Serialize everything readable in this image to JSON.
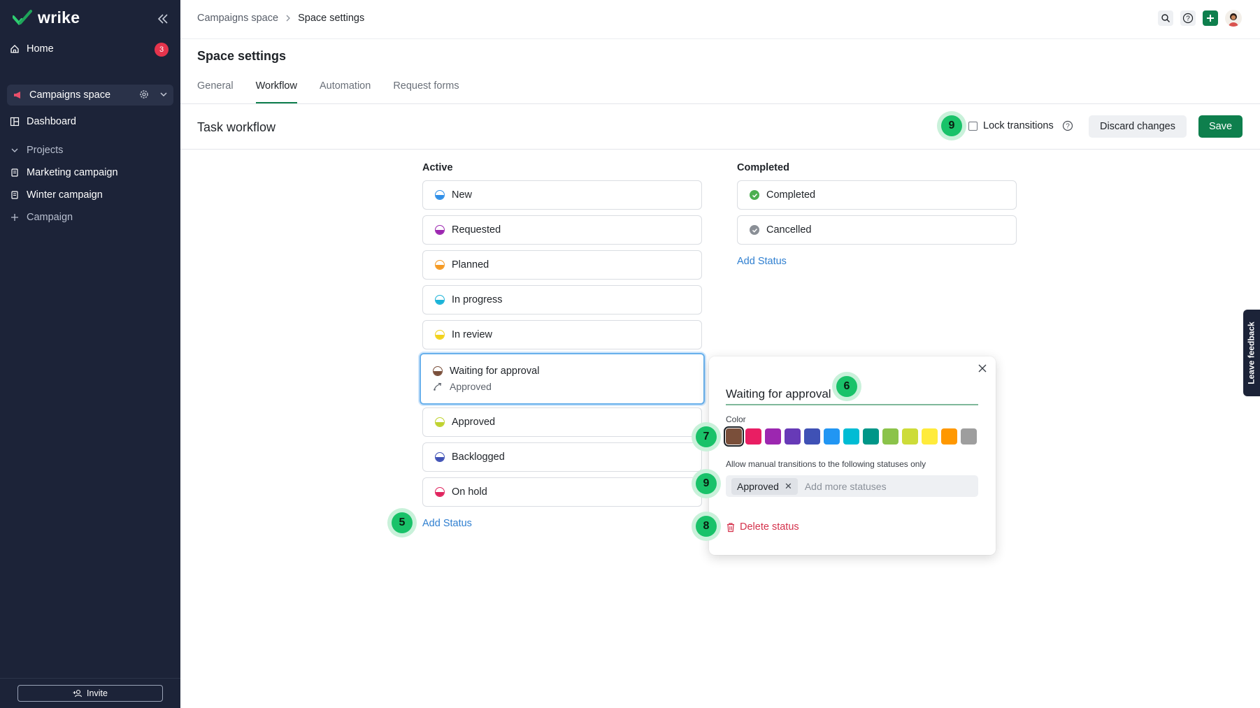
{
  "app": {
    "logo_text": "wrike"
  },
  "sidebar": {
    "home_label": "Home",
    "home_badge": "3",
    "space_name": "Campaigns space",
    "dashboard_label": "Dashboard",
    "projects_label": "Projects",
    "items": [
      {
        "label": "Marketing campaign"
      },
      {
        "label": "Winter campaign"
      }
    ],
    "add_campaign_label": "Campaign",
    "invite_label": "Invite"
  },
  "header": {
    "breadcrumb": [
      "Campaigns space",
      "Space settings"
    ],
    "page_title": "Space settings"
  },
  "tabs": [
    {
      "label": "General",
      "active": false
    },
    {
      "label": "Workflow",
      "active": true
    },
    {
      "label": "Automation",
      "active": false
    },
    {
      "label": "Request forms",
      "active": false
    }
  ],
  "workflow": {
    "title": "Task workflow",
    "lock_label": "Lock transitions",
    "discard_label": "Discard changes",
    "save_label": "Save"
  },
  "active_column": {
    "title": "Active",
    "statuses": [
      {
        "label": "New",
        "color": "#2f8fe8"
      },
      {
        "label": "Requested",
        "color": "#9c27b0"
      },
      {
        "label": "Planned",
        "color": "#f59a23"
      },
      {
        "label": "In progress",
        "color": "#1bb3d8"
      },
      {
        "label": "In review",
        "color": "#f2d21b"
      },
      {
        "label": "Waiting for approval",
        "color": "#7a4f3a",
        "transition": "Approved"
      },
      {
        "label": "Approved",
        "color": "#bfd22e"
      },
      {
        "label": "Backlogged",
        "color": "#3f51b5"
      },
      {
        "label": "On hold",
        "color": "#e0245e"
      }
    ],
    "add_status_label": "Add Status"
  },
  "completed_column": {
    "title": "Completed",
    "statuses": [
      {
        "label": "Completed",
        "color": "#4caf50"
      },
      {
        "label": "Cancelled",
        "color": "#8a8f96"
      }
    ],
    "add_status_label": "Add Status"
  },
  "popover": {
    "status_name": "Waiting for approval",
    "color_label": "Color",
    "colors": [
      "#7a4f3a",
      "#e91e63",
      "#9c27b0",
      "#673ab7",
      "#3f51b5",
      "#2196f3",
      "#00bcd4",
      "#009688",
      "#8bc34a",
      "#cddc39",
      "#ffeb3b",
      "#ff9800",
      "#9e9e9e"
    ],
    "allow_label": "Allow manual transitions to the following statuses only",
    "chip_label": "Approved",
    "placeholder": "Add more statuses",
    "delete_label": "Delete status"
  },
  "markers": {
    "lock": "9",
    "add_status": "5",
    "name": "6",
    "color": "7",
    "transitions": "9",
    "delete": "8"
  },
  "feedback_label": "Leave feedback"
}
